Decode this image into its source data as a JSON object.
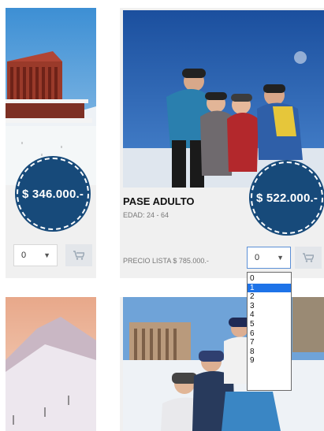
{
  "cards": [
    {
      "price": "$ 346.000.-",
      "qty": "0"
    },
    {
      "title": "PASE ADULTO",
      "subtitle": "EDAD: 24 - 64",
      "price": "$ 522.000.-",
      "list_price": "PRECIO LISTA $ 785.000.-",
      "qty": "0"
    }
  ],
  "dropdown": {
    "options": [
      "0",
      "1",
      "2",
      "3",
      "4",
      "5",
      "6",
      "7",
      "8",
      "9"
    ],
    "selected": "1"
  },
  "colors": {
    "badge": "#174a7a",
    "highlight": "#1e73e8"
  }
}
